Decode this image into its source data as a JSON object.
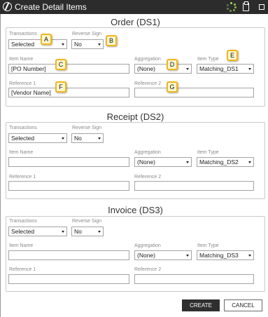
{
  "window": {
    "title": "Create Detail Items",
    "icons": [
      "app-logo-icon",
      "spinner-icon",
      "clipboard-icon",
      "maximize-icon"
    ]
  },
  "labels": {
    "transactions": "Transactions",
    "reverse_sign": "Reverse Sign",
    "item_name": "Item Name",
    "aggregation": "Aggregation",
    "item_type": "Item Type",
    "reference1": "Reference 1",
    "reference2": "Reference 2"
  },
  "sections": [
    {
      "title": "Order (DS1)",
      "transactions": "Selected",
      "reverse_sign": "No",
      "item_name": "[PO Number]",
      "aggregation": "(None)",
      "item_type": "Matching_DS1",
      "reference1": "[Vendor Name]",
      "reference2": ""
    },
    {
      "title": "Receipt (DS2)",
      "transactions": "Selected",
      "reverse_sign": "No",
      "item_name": "",
      "aggregation": "(None)",
      "item_type": "Matching_DS2",
      "reference1": "",
      "reference2": ""
    },
    {
      "title": "Invoice (DS3)",
      "transactions": "Selected",
      "reverse_sign": "No",
      "item_name": "",
      "aggregation": "(None)",
      "item_type": "Matching_DS3",
      "reference1": "",
      "reference2": ""
    }
  ],
  "callouts": [
    "A",
    "B",
    "C",
    "D",
    "E",
    "F",
    "G"
  ],
  "buttons": {
    "create": "CREATE",
    "cancel": "CANCEL"
  },
  "colors": {
    "titlebar": "#2c2c2c",
    "callout_border": "#f2b51b",
    "callout_fill": "#fff8cf",
    "primary_button": "#2f2f2f"
  }
}
